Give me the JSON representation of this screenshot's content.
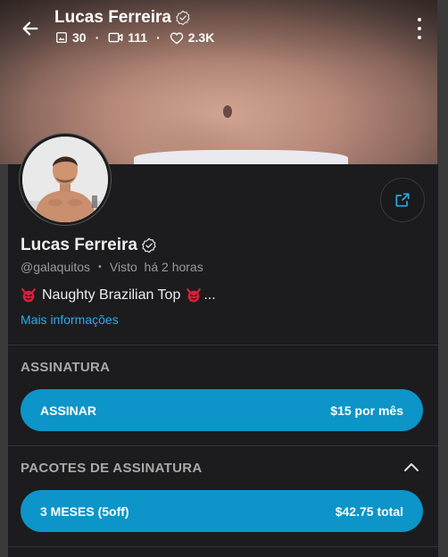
{
  "header": {
    "title": "Lucas Ferreira",
    "stats": {
      "photos": "30",
      "videos": "111",
      "likes": "2.3K"
    }
  },
  "profile": {
    "name": "Lucas Ferreira",
    "username": "@galaquitos",
    "last_seen": "Visto  há 2 horas",
    "bio": "Naughty Brazilian Top",
    "bio_ellipsis": "...",
    "more_info": "Mais informações"
  },
  "subscription": {
    "section_label": "ASSINATURA",
    "button_label": "ASSINAR",
    "button_price": "$15 por mês"
  },
  "bundles": {
    "section_label": "PACOTES DE ASSINATURA",
    "items": [
      {
        "label": "3 MESES (5off)",
        "price": "$42.75 total"
      }
    ]
  },
  "icons": {
    "back": "arrow-left-icon",
    "verified": "verified-badge-icon",
    "photos": "image-icon",
    "videos": "video-icon",
    "likes": "heart-icon",
    "more": "more-vertical-icon",
    "share": "share-icon",
    "collapse": "chevron-up-icon"
  },
  "colors": {
    "accent": "#0d94c9",
    "link": "#30a9e8",
    "panel": "#1c1c1e"
  }
}
